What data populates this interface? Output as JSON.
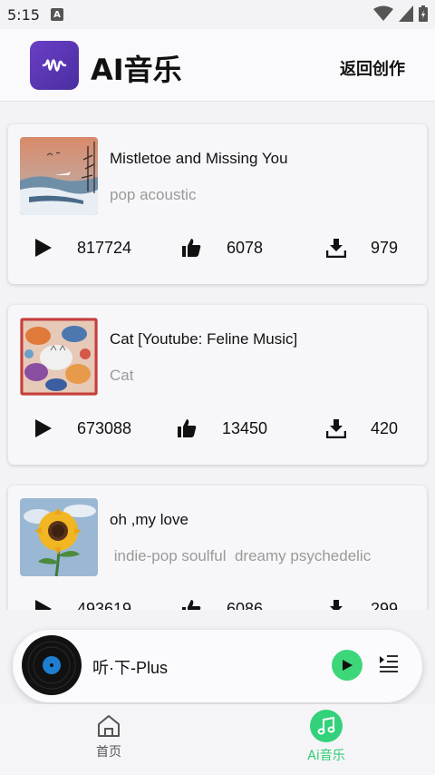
{
  "status": {
    "time": "5:15",
    "notif_glyph": "A"
  },
  "header": {
    "title": "AI音乐",
    "back_label": "返回创作",
    "brand_color": "#5b34b5"
  },
  "songs": [
    {
      "title": "Mistletoe and Missing You",
      "tags": "pop acoustic",
      "plays": "817724",
      "likes": "6078",
      "downloads": "979"
    },
    {
      "title": "Cat [Youtube: Feline Music]",
      "tags": "Cat",
      "plays": "673088",
      "likes": "13450",
      "downloads": "420"
    },
    {
      "title": "oh ,my love",
      "tags": " indie-pop soulful  dreamy psychedelic",
      "plays": "493619",
      "likes": "6086",
      "downloads": "299"
    }
  ],
  "player": {
    "title": "听·下-Plus",
    "accent": "#3dd77a"
  },
  "nav": {
    "home_label": "首页",
    "music_label": "Ai音乐",
    "active_color": "#2ecc71"
  }
}
